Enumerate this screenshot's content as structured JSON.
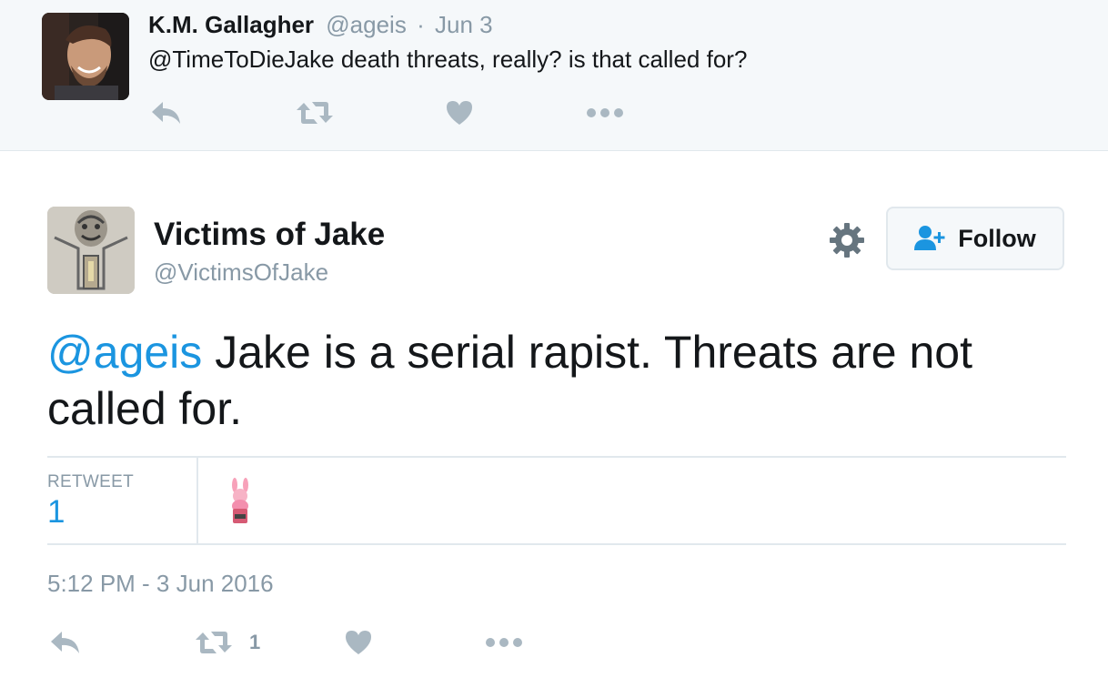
{
  "parent_tweet": {
    "name": "K.M. Gallagher",
    "handle": "@ageis",
    "separator": "·",
    "date": "Jun 3",
    "text": "@TimeToDieJake death threats, really? is that called for?",
    "actions": [
      "reply-icon",
      "retweet-icon",
      "like-icon",
      "more-icon"
    ]
  },
  "main_tweet": {
    "name": "Victims of Jake",
    "handle": "@VictimsOfJake",
    "follow_label": "Follow",
    "mention": "@ageis",
    "text": " Jake is a serial rapist. Threats are not called for.",
    "stats": {
      "retweet_label": "RETWEET",
      "retweet_count": "1"
    },
    "timestamp": "5:12 PM - 3 Jun 2016",
    "actions": {
      "retweet_count": "1"
    }
  },
  "colors": {
    "link": "#1b95e0",
    "muted": "#8899a6",
    "icon": "#aab8c2",
    "context_bg": "#f5f8fa",
    "border": "#e1e8ed"
  }
}
